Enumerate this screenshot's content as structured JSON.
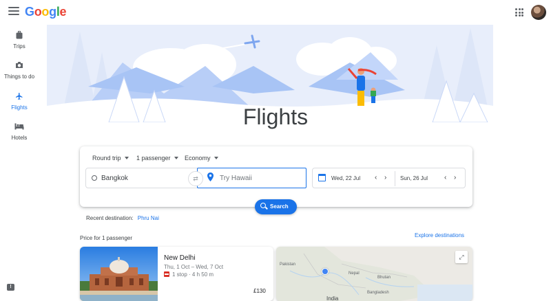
{
  "header": {
    "logo_letters": [
      "G",
      "o",
      "o",
      "g",
      "l",
      "e"
    ],
    "menu_icon": "hamburger-menu-icon",
    "apps_icon": "apps-grid-icon"
  },
  "sidebar": {
    "items": [
      {
        "label": "Trips",
        "icon": "suitcase-icon",
        "active": false
      },
      {
        "label": "Things to do",
        "icon": "camera-icon",
        "active": false
      },
      {
        "label": "Flights",
        "icon": "airplane-icon",
        "active": true
      },
      {
        "label": "Hotels",
        "icon": "bed-icon",
        "active": false
      }
    ]
  },
  "hero": {
    "title": "Flights"
  },
  "search": {
    "trip_type": "Round trip",
    "passengers": "1 passenger",
    "cabin": "Economy",
    "origin": "Bangkok",
    "destination_placeholder": "Try Hawaii",
    "depart_date": "Wed, 22 Jul",
    "return_date": "Sun, 26 Jul",
    "prev_symbol": "‹",
    "next_symbol": "›",
    "button_label": "Search"
  },
  "recent": {
    "label": "Recent destination:",
    "destination": "Phru Nai"
  },
  "explore": {
    "price_label": "Price for 1 passenger",
    "explore_link": "Explore destinations"
  },
  "result": {
    "city": "New Delhi",
    "dates": "Thu, 1 Oct – Wed, 7 Oct",
    "stops": "1 stop · 4 h 50 m",
    "price": "£130"
  },
  "map": {
    "labels": {
      "pakistan": "Pakistan",
      "nepal": "Nepal",
      "bhutan": "Bhutan",
      "bangladesh": "Bangladesh",
      "india": "India"
    }
  },
  "colors": {
    "accent": "#1a73e8",
    "hero_sky": "#e8eefb",
    "hero_mountain": "#a8c4f5"
  }
}
